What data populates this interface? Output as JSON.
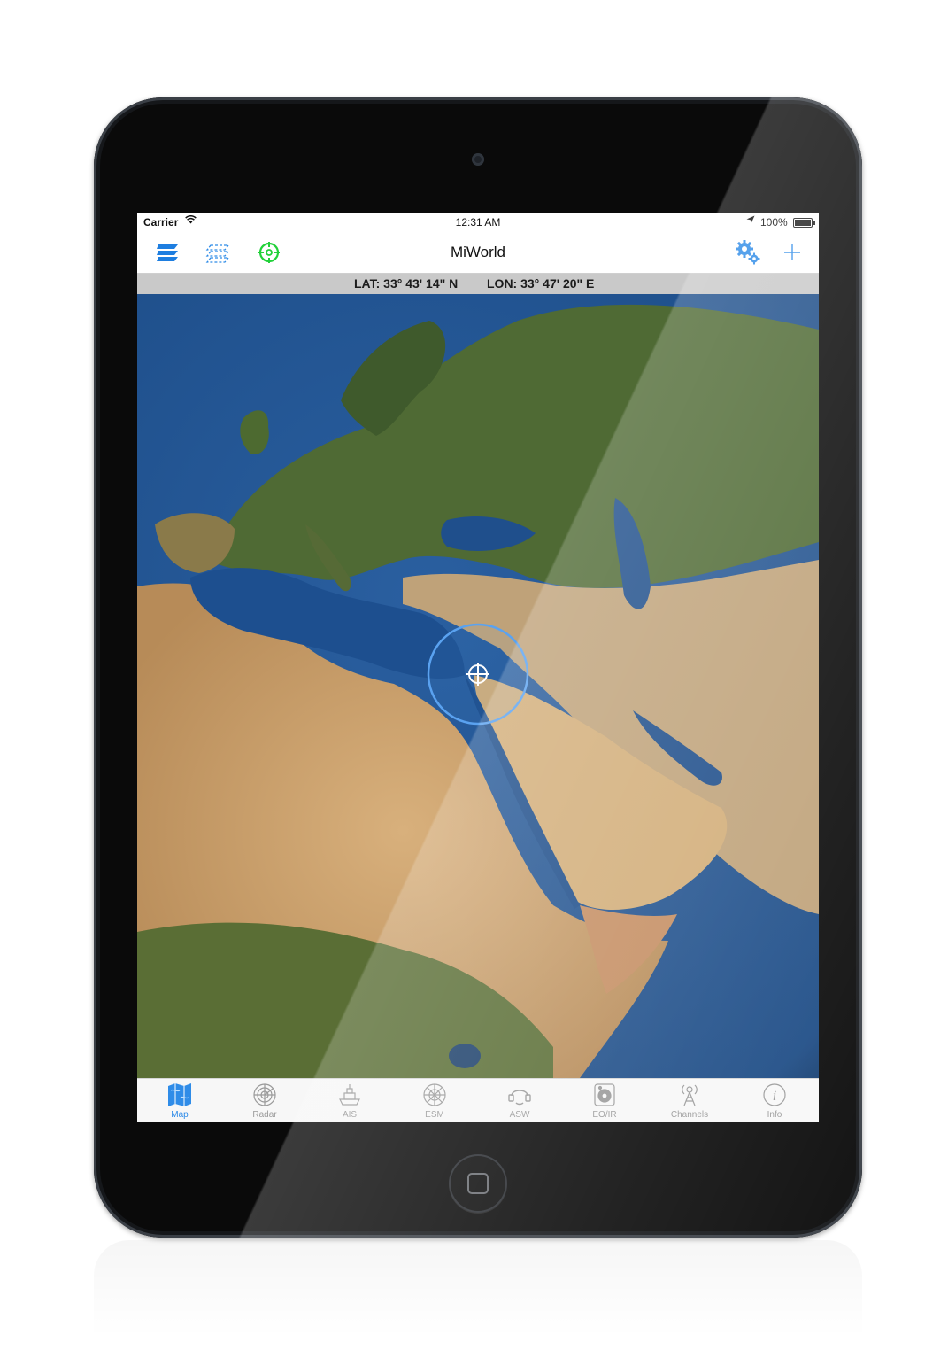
{
  "status_bar": {
    "carrier": "Carrier",
    "time": "12:31 AM",
    "battery": "100%"
  },
  "nav": {
    "title": "MiWorld",
    "icons": [
      "layers-icon",
      "grid-overlay-icon",
      "target-icon",
      "settings-icon",
      "add-icon"
    ]
  },
  "coordinates": {
    "lat": "LAT: 33° 43' 14\" N",
    "lon": "LON: 33° 47' 20\" E"
  },
  "tabs": [
    {
      "label": "Map",
      "icon": "map-icon",
      "active": true
    },
    {
      "label": "Radar",
      "icon": "radar-icon",
      "active": false
    },
    {
      "label": "AIS",
      "icon": "ship-icon",
      "active": false
    },
    {
      "label": "ESM",
      "icon": "esm-icon",
      "active": false
    },
    {
      "label": "ASW",
      "icon": "sonar-icon",
      "active": false
    },
    {
      "label": "EO/IR",
      "icon": "camera-icon",
      "active": false
    },
    {
      "label": "Channels",
      "icon": "antenna-icon",
      "active": false
    },
    {
      "label": "Info",
      "icon": "info-icon",
      "active": false
    }
  ],
  "colors": {
    "accent": "#2f8ce8",
    "target_green": "#22d13a",
    "ocean": "#1d4d8a",
    "land_desert": "#c9a06e",
    "land_green": "#4d6a2e"
  }
}
